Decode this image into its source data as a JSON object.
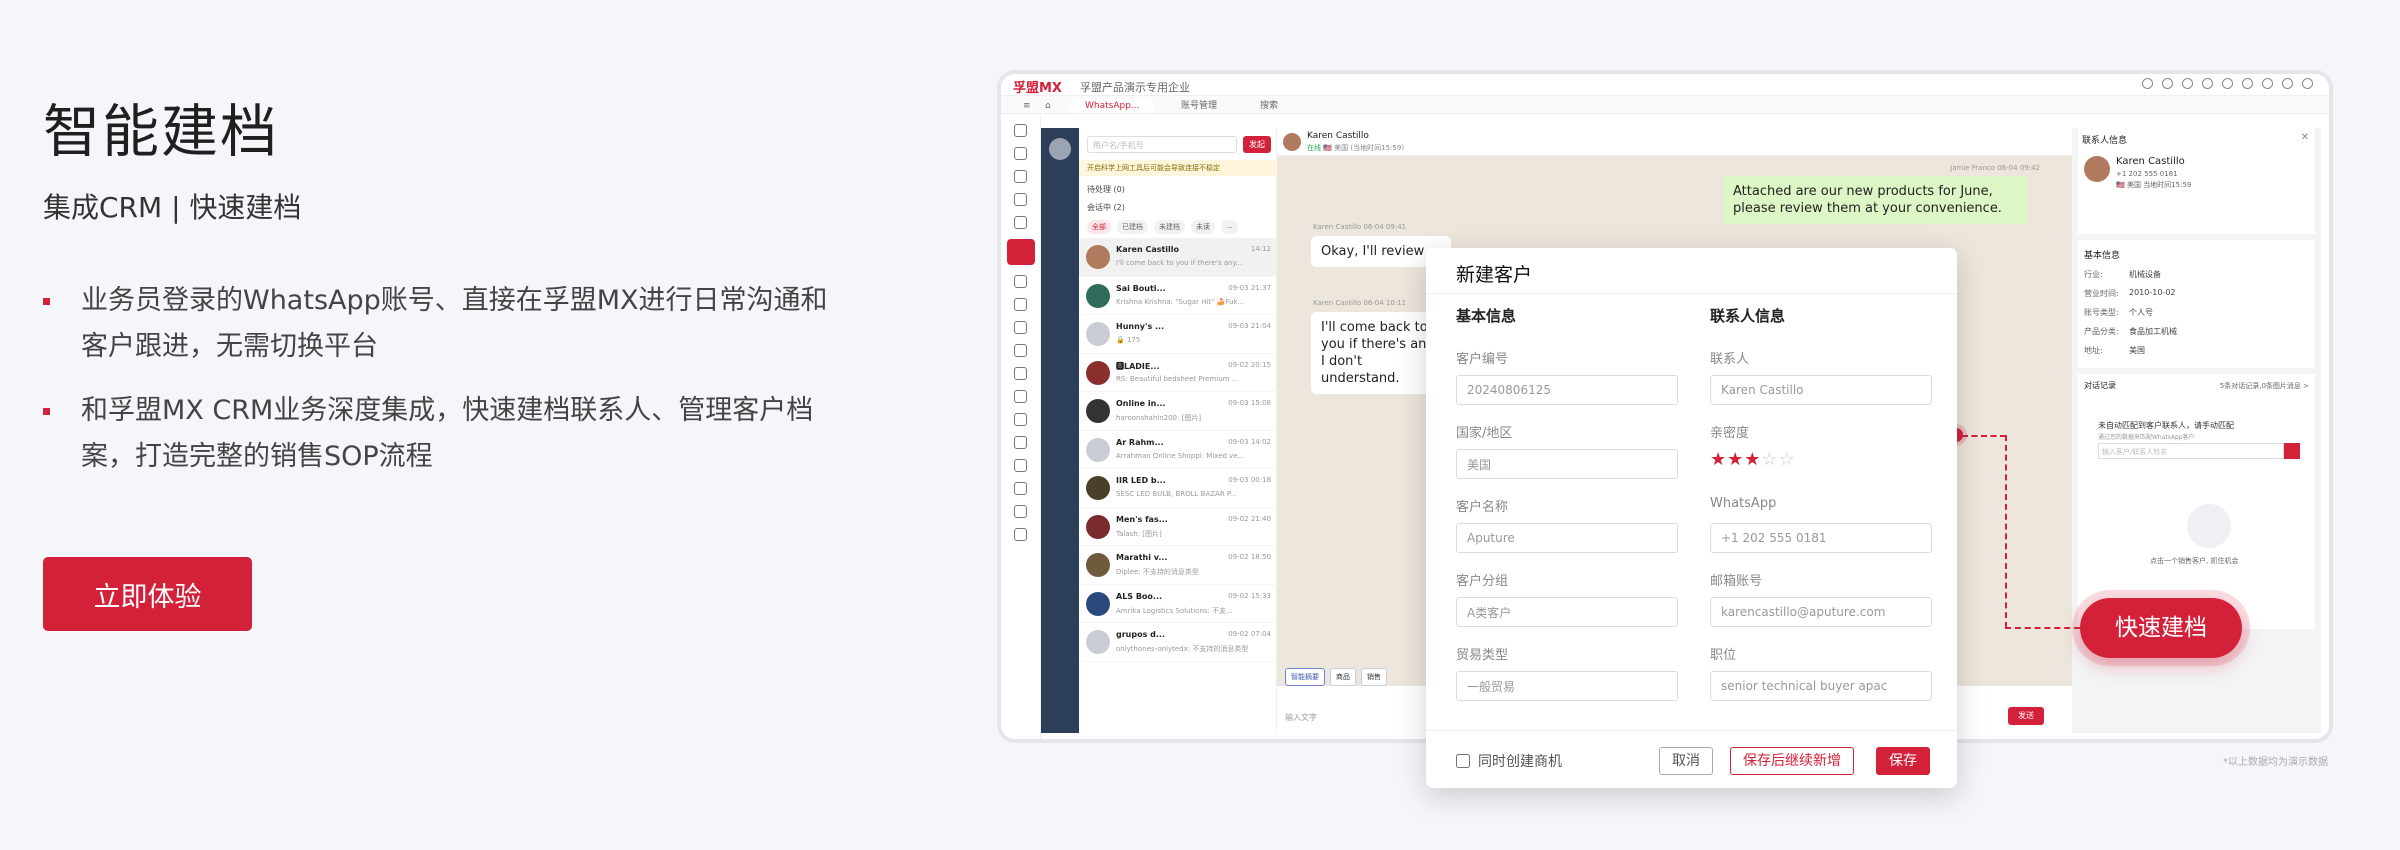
{
  "left": {
    "title": "智能建档",
    "subtitle": "集成CRM | 快速建档",
    "bullets": [
      "业务员登录的WhatsApp账号、直接在孚盟MX进行日常沟通和客户跟进，无需切换平台",
      "和孚盟MX CRM业务深度集成，快速建档联系人、管理客户档案，打造完整的销售SOP流程"
    ],
    "cta": "立即体验"
  },
  "app": {
    "logo": "孚盟MX",
    "org": "孚盟产品演示专用企业",
    "tabs": [
      "WhatsApp...",
      "账号管理",
      "搜索"
    ],
    "search_placeholder": "用户名/手机号",
    "new_button": "发起",
    "notice": "开启科学上网工具后可能会导致连接不稳定",
    "group_pending": "待处理 (0)",
    "group_active": "会话中 (2)",
    "filters": [
      "全部",
      "已建档",
      "未建档",
      "未读",
      "..."
    ],
    "chats": [
      {
        "name": "Karen Castillo",
        "time": "14:12",
        "preview": "I'll come back to you if there's any..."
      },
      {
        "name": "Sai Bouti...",
        "time": "09-03 21:37",
        "preview": "Krishna Krishna: \"Sugar Hit\" 🍰Fuk..."
      },
      {
        "name": "Hunny's ...",
        "time": "09-03 21:04",
        "preview": "🔒 175"
      },
      {
        "name": "🅱LADIE...",
        "time": "09-02 20:15",
        "preview": "RS: Beautiful bedsheet Premium ..."
      },
      {
        "name": "Online in...",
        "time": "09-03 15:08",
        "preview": "haroonshahin200: [图片]"
      },
      {
        "name": "Ar Rahm...",
        "time": "09-03 14:02",
        "preview": "Arrahman Online Shoppi: Mixed ve..."
      },
      {
        "name": "IIR LED b...",
        "time": "09-03 00:18",
        "preview": "SESC LED BULB, BROLL BAZAR P..."
      },
      {
        "name": "Men's fas...",
        "time": "09-02 21:40",
        "preview": "Talash: [图片]"
      },
      {
        "name": "Marathi v...",
        "time": "09-02 18:50",
        "preview": "Diplee: 不支持的消息类型"
      },
      {
        "name": "ALS Boo...",
        "time": "09-02 15:33",
        "preview": "Amrika Logistics Solutions: 不支..."
      },
      {
        "name": "grupos d...",
        "time": "09-02 07:04",
        "preview": "onlythones-onlytedx: 不支持的消息类型"
      }
    ],
    "chat_header": {
      "name": "Karen Castillo",
      "status": "在线",
      "country": "🇺🇸 美国",
      "localtime": "(当地时间15:59)"
    },
    "messages": {
      "out1": "Attached are our new products for June, please review them at your convenience.",
      "out1_meta": "Jamie Franco 06-04 09:42",
      "in1": "Okay, I'll review",
      "in1_meta": "Karen Castillo 06-04 09:41",
      "in2": "I'll come back to you if there's any I don't understand.",
      "in2_meta": "Karen Castillo 06-04 10:11"
    },
    "toolbar": [
      "智能摘要",
      "商品",
      "销售"
    ],
    "input_placeholder": "输入文字",
    "send": "发送",
    "contact_panel": {
      "title": "联系人信息",
      "name": "Karen Castillo",
      "phone": "+1 202 555 0181",
      "country": "🇺🇸 美国",
      "localtime": "当地时间15:59",
      "basic_title": "基本信息",
      "rows": [
        {
          "k": "行业:",
          "v": "机械设备"
        },
        {
          "k": "营业时间:",
          "v": "2010-10-02"
        },
        {
          "k": "账号类型:",
          "v": "个人号"
        },
        {
          "k": "产品分类:",
          "v": "食品加工机械"
        },
        {
          "k": "地址:",
          "v": "美国"
        }
      ],
      "records_title": "对话记录",
      "records_meta": "5条对话记录,0条图片消息 >",
      "match_title": "未自动匹配到客户联系人，请手动匹配",
      "match_sub": "通过您的数据来匹配WhatsApp客户",
      "match_placeholder": "输入客户/联系人姓名",
      "empty_tip": "点击一个销售客户, 抓住机会"
    }
  },
  "quick_button": "快速建档",
  "modal": {
    "title": "新建客户",
    "basic": "基本信息",
    "contact": "联系人信息",
    "fields_left": [
      {
        "label": "客户编号",
        "value": "20240806125"
      },
      {
        "label": "国家/地区",
        "value": "美国"
      },
      {
        "label": "客户名称",
        "value": "Aputure"
      },
      {
        "label": "客户分组",
        "value": "A类客户"
      },
      {
        "label": "贸易类型",
        "value": "一般贸易"
      }
    ],
    "fields_right": [
      {
        "label": "联系人",
        "value": "Karen Castillo"
      },
      {
        "label": "亲密度",
        "value": ""
      },
      {
        "label": "WhatsApp",
        "value": "+1 202 555 0181"
      },
      {
        "label": "邮箱账号",
        "value": "karencastillo@aputure.com"
      },
      {
        "label": "职位",
        "value": "senior technical buyer apac"
      }
    ],
    "intimacy": 3,
    "checkbox": "同时创建商机",
    "cancel": "取消",
    "save_new": "保存后继续新增",
    "save": "保存"
  },
  "footnote": "*以上数据均为演示数据"
}
